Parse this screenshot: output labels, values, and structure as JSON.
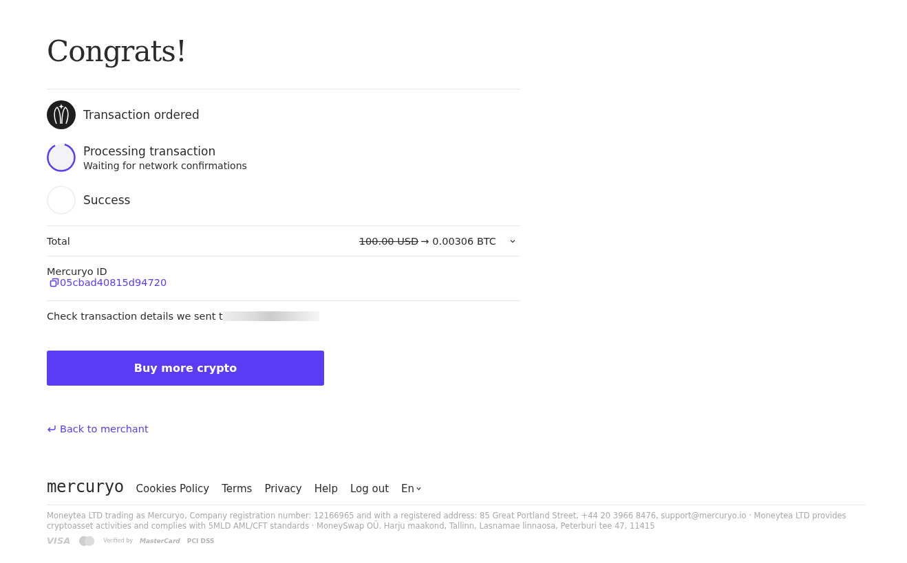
{
  "title": "Congrats!",
  "steps": [
    {
      "label": "Transaction ordered",
      "kind": "done"
    },
    {
      "label": "Processing transaction",
      "sublabel": "Waiting for network confirmations",
      "kind": "processing"
    },
    {
      "label": "Success",
      "kind": "pending"
    }
  ],
  "total": {
    "label": "Total",
    "amount_from": "100.00 USD",
    "arrow": "→",
    "amount_to": "0.00306 BTC",
    "expanded": false
  },
  "mercuryo_id": {
    "label": "Mercuryo ID",
    "value": "05cbad40815d94720"
  },
  "email_note": "Check transaction details we sent t",
  "buy_button": "Buy more crypto",
  "back_link": "Back to merchant",
  "footer": {
    "logo": "mercuryo",
    "links": [
      "Cookies Policy",
      "Terms",
      "Privacy",
      "Help",
      "Log out"
    ],
    "language": "En",
    "legal": "Moneytea LTD trading as Mercuryo, Company registration number: 12166965 and with a registered address: 85 Great Portland Street, +44 20 3966 8476, support@mercuryo.io · Moneytea LTD provides cryptoasset activities and complies with 5MLD AML/CFT standards · MoneySwap OÜ. Harju maakond, Tallinn, Lasnamae linnaosa, Peterburi tee 47, 11415",
    "badges": [
      {
        "kind": "visa",
        "text": "VISA"
      },
      {
        "kind": "verified",
        "text": "Verified by"
      },
      {
        "kind": "mastercard",
        "text": "MasterCard"
      },
      {
        "kind": "pci",
        "text": "PCI DSS"
      }
    ]
  }
}
